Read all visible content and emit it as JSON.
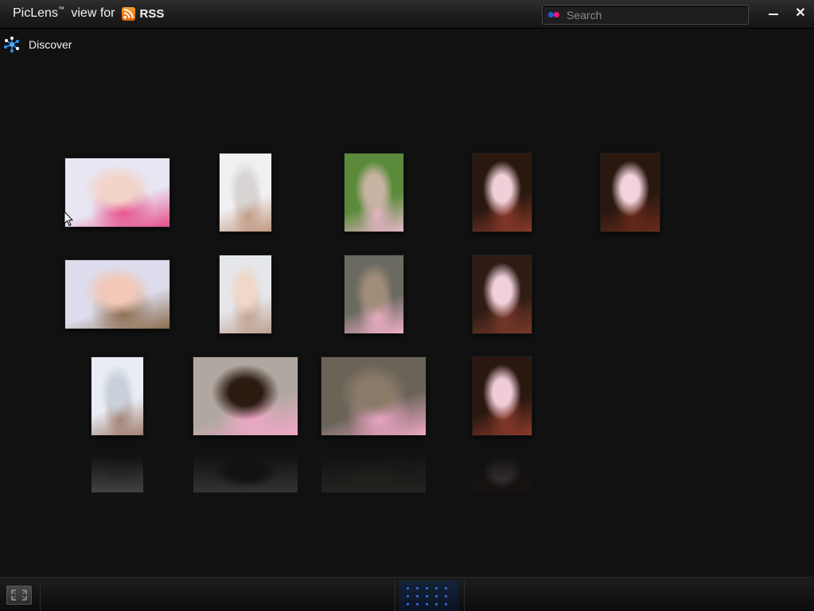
{
  "window": {
    "title_app": "PicLens",
    "title_tm": "™",
    "title_rest": " view for",
    "source_label": "RSS",
    "minimize_icon": "minimize-icon",
    "close_icon": "close-icon",
    "close_glyph": "✕"
  },
  "search": {
    "placeholder": "Search",
    "value": "",
    "provider_icon": "flickr-icon",
    "colors": {
      "blue": "#1b5ed8",
      "pink": "#e8197a"
    }
  },
  "discover": {
    "label": "Discover",
    "icon": "discover-icon"
  },
  "photos": [
    {
      "subject": "baby-bonnet-closeup",
      "colors": [
        "#e8e6f2",
        "#f3d4c8",
        "#e64c8a"
      ]
    },
    {
      "subject": "baby-white-hat-top",
      "colors": [
        "#f0f0f2",
        "#d8d4d4",
        "#c09880"
      ]
    },
    {
      "subject": "toddler-sitting-outdoor",
      "colors": [
        "#5a8a3a",
        "#c8b4a2",
        "#e8b6c8"
      ]
    },
    {
      "subject": "toddler-restaurant-cup",
      "colors": [
        "#2a1810",
        "#f0d0d8",
        "#8a3a2a"
      ]
    },
    {
      "subject": "toddler-restaurant-cup-2",
      "colors": [
        "#2a1810",
        "#f2d2dc",
        "#6a2a1a"
      ]
    },
    {
      "subject": "baby-bonnet-lying",
      "colors": [
        "#dcdcec",
        "#f2c8b8",
        "#8a6a4a"
      ]
    },
    {
      "subject": "baby-mirror-view",
      "colors": [
        "#e4e6ea",
        "#f0d8c8",
        "#c0a090"
      ]
    },
    {
      "subject": "toddler-fountain-sitting",
      "colors": [
        "#6a6a60",
        "#a08c78",
        "#f0b0c8"
      ]
    },
    {
      "subject": "toddler-restaurant-chair",
      "colors": [
        "#301c14",
        "#f0d0dc",
        "#7a3a2a"
      ]
    },
    {
      "subject": "baby-white-hat-bottom",
      "colors": [
        "#e8ecf4",
        "#c8d0da",
        "#a08070"
      ]
    },
    {
      "subject": "toddler-crouching-paving",
      "colors": [
        "#b0a8a0",
        "#2a1a10",
        "#f2a8c8"
      ]
    },
    {
      "subject": "toddler-fountain-back",
      "colors": [
        "#6a6458",
        "#8a7a68",
        "#f0a8c8"
      ]
    },
    {
      "subject": "toddler-restaurant-cup-3",
      "colors": [
        "#2a1810",
        "#f0ccd8",
        "#8a3a2a"
      ]
    }
  ],
  "bottom_bar": {
    "fullscreen_icon": "fullscreen-icon",
    "grid_icon": "grid-view-icon",
    "accent": "#2f6fd8"
  }
}
